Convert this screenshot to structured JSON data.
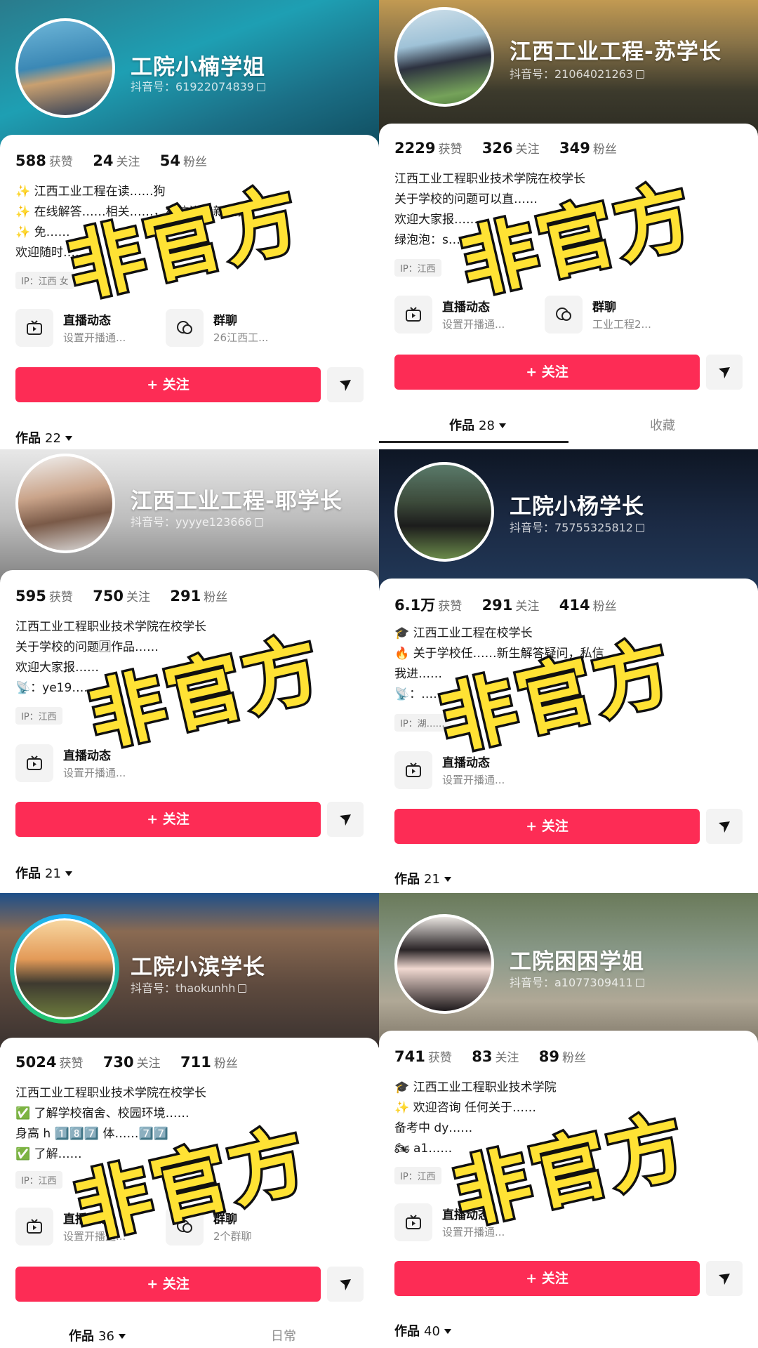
{
  "stamp_text": "非官方",
  "common": {
    "live_title": "直播动态",
    "live_sub": "设置开播通...",
    "group_title": "群聊",
    "follow_label": "+ 关注",
    "works_label": "作品",
    "ip_prefix": "IP："
  },
  "colors": {
    "follow": "#fd2c55",
    "stamp_fill": "#ffe234",
    "stamp_stroke": "#111111"
  },
  "profiles": [
    {
      "name": "工院小楠学姐",
      "douyin_id": "抖音号：61922074839",
      "likes": "588",
      "likes_label": "获赞",
      "following": "24",
      "following_label": "关注",
      "fans": "54",
      "fans_label": "粉丝",
      "bio": [
        "✨ 江西工业工程在读……狗",
        "✨ 在线解答……相关……，私信进我新生群。",
        "✨ 免……",
        "欢迎随时……"
      ],
      "ip": "IP：江西  女",
      "group_sub": "26江西工...",
      "works_count": "22"
    },
    {
      "name": "江西工业工程-苏学长",
      "douyin_id": "抖音号：21064021263",
      "likes": "2229",
      "likes_label": "获赞",
      "following": "326",
      "following_label": "关注",
      "fans": "349",
      "fans_label": "粉丝",
      "bio": [
        "江西工业工程职业技术学院在校学长",
        "关于学校的问题可以直……",
        "欢迎大家报……",
        "绿泡泡：s……"
      ],
      "ip": "IP：江西",
      "group_sub": "工业工程2...",
      "works_count": "28",
      "tab_collect": "收藏"
    },
    {
      "name": "江西工业工程-耶学长",
      "douyin_id": "抖音号：yyyye123666",
      "likes": "595",
      "likes_label": "获赞",
      "following": "750",
      "following_label": "关注",
      "fans": "291",
      "fans_label": "粉丝",
      "bio": [
        "江西工业工程职业技术学院在校学长",
        "关于学校的问题🈷作品……",
        "欢迎大家报……",
        "📡：ye19……"
      ],
      "ip": "IP：江西",
      "works_count": "21"
    },
    {
      "name": "工院小杨学长",
      "douyin_id": "抖音号：75755325812",
      "likes": "6.1万",
      "likes_label": "获赞",
      "following": "291",
      "following_label": "关注",
      "fans": "414",
      "fans_label": "粉丝",
      "bio": [
        "🎓 江西工业工程在校学长",
        "🔥 关于学校任……新生解答疑问，私信",
        "我进……",
        "📡：……"
      ],
      "ip": "IP：湖……",
      "works_count": "21"
    },
    {
      "name": "工院小滨学长",
      "douyin_id": "抖音号：thaokunhh",
      "likes": "5024",
      "likes_label": "获赞",
      "following": "730",
      "following_label": "关注",
      "fans": "711",
      "fans_label": "粉丝",
      "bio": [
        "江西工业工程职业技术学院在校学长",
        "✅ 了解学校宿舍、校园环境……",
        "身高 h 1️⃣8️⃣7️⃣ 体……7️⃣7️⃣",
        "✅ 了解……"
      ],
      "ip": "IP：江西",
      "group_sub": "2个群聊",
      "works_count": "36",
      "tab_daily": "日常"
    },
    {
      "name": "工院困困学姐",
      "douyin_id": "抖音号：a1077309411",
      "likes": "741",
      "likes_label": "获赞",
      "following": "83",
      "following_label": "关注",
      "fans": "89",
      "fans_label": "粉丝",
      "bio": [
        "🎓 江西工业工程职业技术学院",
        "✨ 欢迎咨询 任何关于……",
        "备考中 dy……",
        "🏍 a1……"
      ],
      "ip": "IP：江西",
      "works_count": "40"
    }
  ]
}
